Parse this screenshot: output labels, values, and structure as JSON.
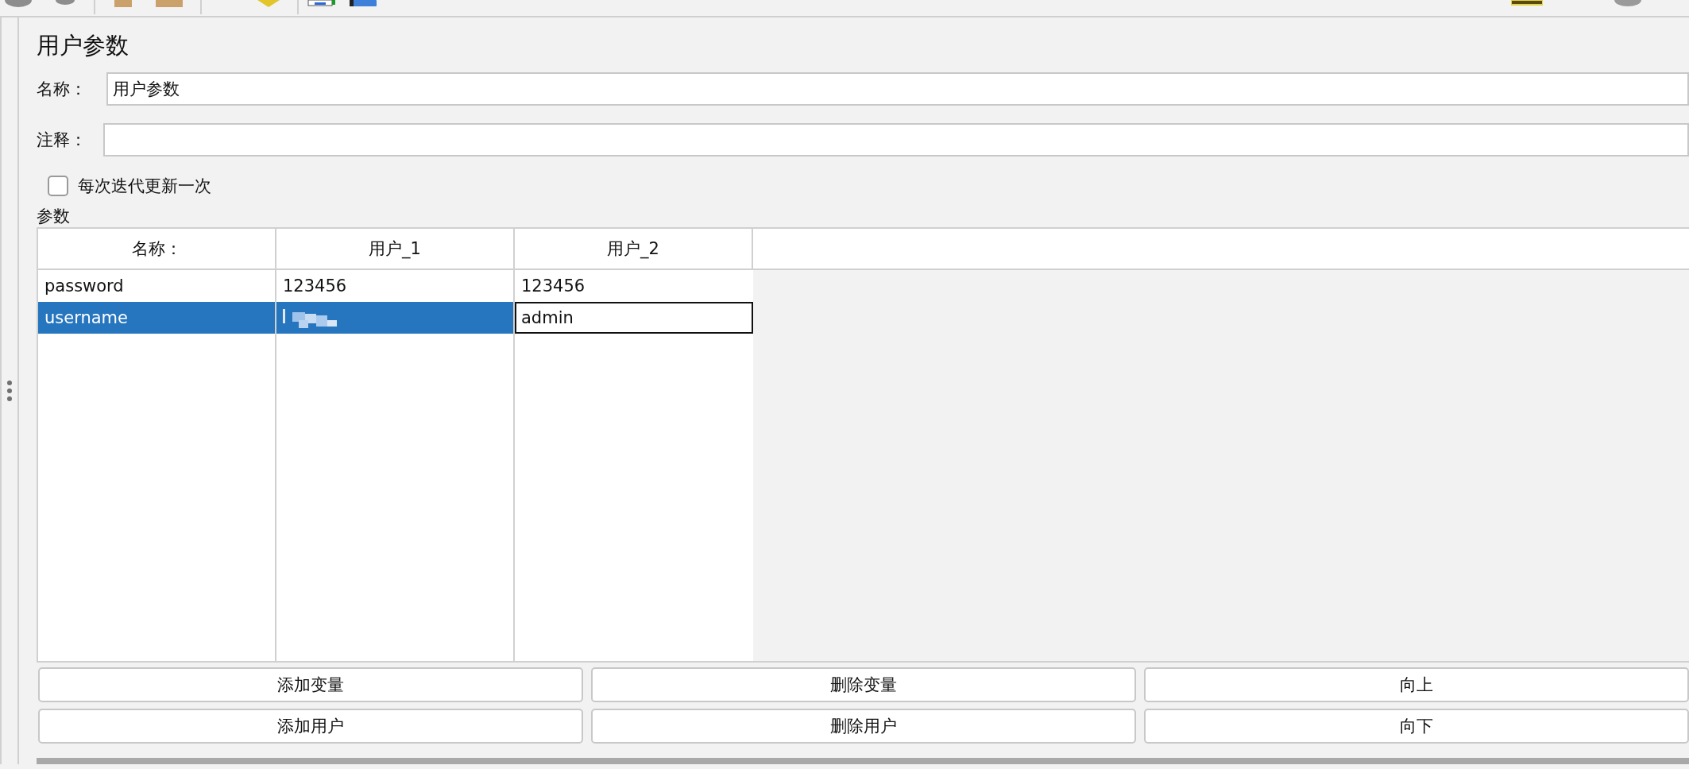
{
  "title": "用户参数",
  "fields": [
    {
      "label": "名称：",
      "value": "用户参数"
    },
    {
      "label": "注释："
    }
  ],
  "checkbox": {
    "label": "每次迭代更新一次",
    "checked": false
  },
  "section_label": "参数",
  "table": {
    "columns": [
      "名称：",
      "用户_1",
      "用户_2"
    ],
    "rows": [
      {
        "selected": false,
        "cells": [
          {
            "text": "password"
          },
          {
            "text": "123456"
          },
          {
            "text": "123456"
          }
        ]
      },
      {
        "selected": true,
        "cells": [
          {
            "text": "username"
          },
          {
            "blurred": true
          },
          {
            "text": "admin",
            "editing": true
          }
        ]
      }
    ]
  },
  "buttons": [
    [
      "添加变量",
      "删除变量",
      "向上"
    ],
    [
      "添加用户",
      "删除用户",
      "向下"
    ]
  ]
}
